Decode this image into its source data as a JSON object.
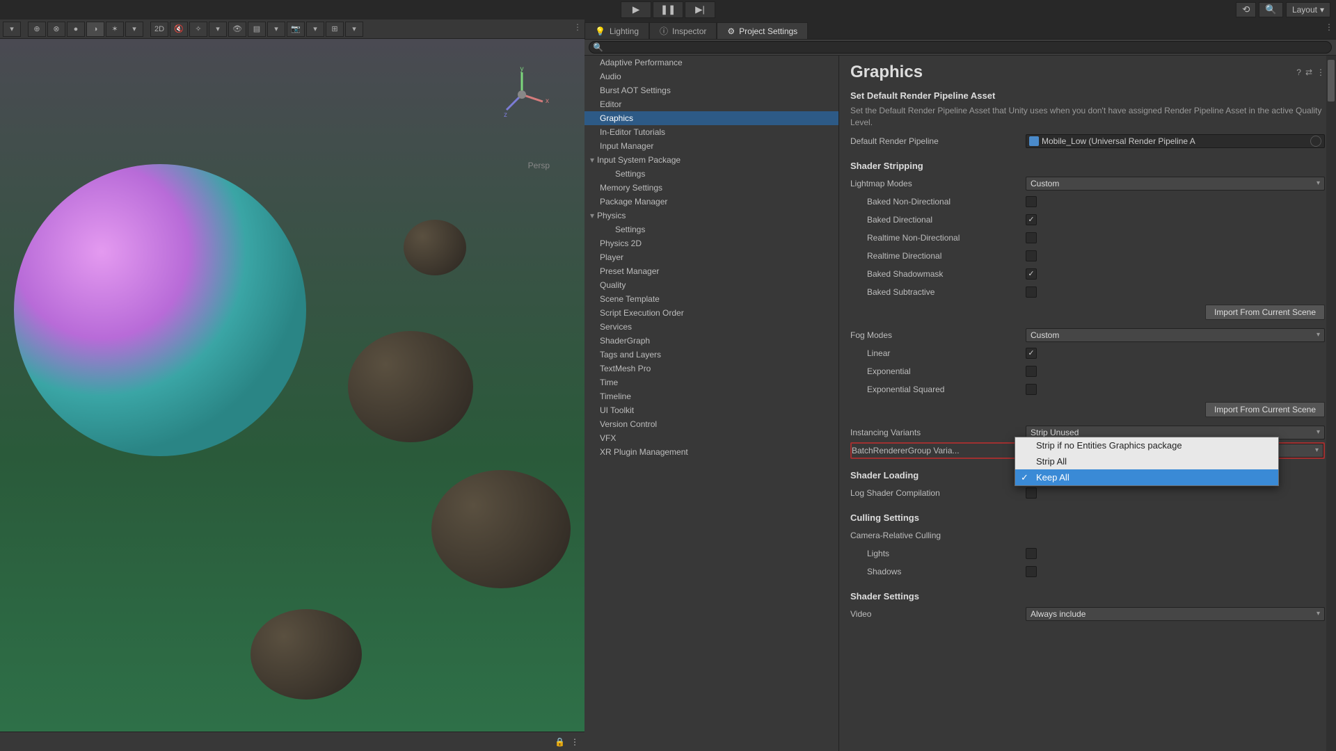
{
  "topbar": {
    "layout_label": "Layout",
    "play_tip": "Play",
    "pause_tip": "Pause",
    "step_tip": "Step"
  },
  "viewport": {
    "persp": "Persp",
    "mode_2d": "2D"
  },
  "tabs": {
    "lighting": "Lighting",
    "inspector": "Inspector",
    "project_settings": "Project Settings"
  },
  "search": {
    "placeholder": ""
  },
  "sidebar": {
    "items": [
      {
        "label": "Adaptive Performance"
      },
      {
        "label": "Audio"
      },
      {
        "label": "Burst AOT Settings"
      },
      {
        "label": "Editor"
      },
      {
        "label": "Graphics",
        "selected": true
      },
      {
        "label": "In-Editor Tutorials"
      },
      {
        "label": "Input Manager"
      },
      {
        "label": "Input System Package",
        "expandable": true
      },
      {
        "label": "Settings",
        "indent": true
      },
      {
        "label": "Memory Settings"
      },
      {
        "label": "Package Manager"
      },
      {
        "label": "Physics",
        "expandable": true
      },
      {
        "label": "Settings",
        "indent": true
      },
      {
        "label": "Physics 2D"
      },
      {
        "label": "Player"
      },
      {
        "label": "Preset Manager"
      },
      {
        "label": "Quality"
      },
      {
        "label": "Scene Template"
      },
      {
        "label": "Script Execution Order"
      },
      {
        "label": "Services"
      },
      {
        "label": "ShaderGraph"
      },
      {
        "label": "Tags and Layers"
      },
      {
        "label": "TextMesh Pro"
      },
      {
        "label": "Time"
      },
      {
        "label": "Timeline"
      },
      {
        "label": "UI Toolkit"
      },
      {
        "label": "Version Control"
      },
      {
        "label": "VFX"
      },
      {
        "label": "XR Plugin Management"
      }
    ]
  },
  "graphics": {
    "title": "Graphics",
    "default_pipeline_heading": "Set Default Render Pipeline Asset",
    "default_pipeline_desc": "Set the Default Render Pipeline Asset that Unity uses when you don't have assigned Render Pipeline Asset in the active Quality Level.",
    "default_pipeline_label": "Default Render Pipeline",
    "default_pipeline_value": "Mobile_Low (Universal Render Pipeline A",
    "shader_stripping": "Shader Stripping",
    "lightmap_modes": "Lightmap Modes",
    "lightmap_modes_value": "Custom",
    "baked_non_dir": "Baked Non-Directional",
    "baked_dir": "Baked Directional",
    "realtime_non_dir": "Realtime Non-Directional",
    "realtime_dir": "Realtime Directional",
    "baked_shadowmask": "Baked Shadowmask",
    "baked_subtractive": "Baked Subtractive",
    "import_btn": "Import From Current Scene",
    "fog_modes": "Fog Modes",
    "fog_modes_value": "Custom",
    "linear": "Linear",
    "exponential": "Exponential",
    "exponential_sq": "Exponential Squared",
    "instancing_variants": "Instancing Variants",
    "instancing_variants_value": "Strip Unused",
    "batch_renderer_group": "BatchRendererGroup Varia...",
    "batch_renderer_group_value": "Keep All",
    "dropdown_options": [
      "Strip if no Entities Graphics package",
      "Strip All",
      "Keep All"
    ],
    "shader_loading": "Shader Loading",
    "log_shader_comp": "Log Shader Compilation",
    "culling_settings": "Culling Settings",
    "camera_relative_culling": "Camera-Relative Culling",
    "lights": "Lights",
    "shadows": "Shadows",
    "shader_settings": "Shader Settings",
    "video": "Video",
    "video_value": "Always include"
  }
}
